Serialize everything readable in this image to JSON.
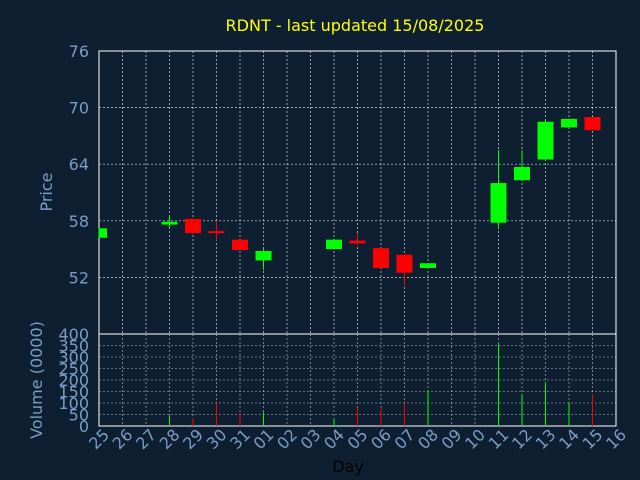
{
  "chart_data": {
    "type": "candlestick",
    "title": "RDNT - last updated 15/08/2025",
    "price_ylabel": "Price",
    "volume_ylabel": "Volume (0000)",
    "xlabel": "Day",
    "x_tick_labels": [
      "25",
      "26",
      "27",
      "28",
      "29",
      "30",
      "31",
      "01",
      "02",
      "03",
      "04",
      "05",
      "06",
      "07",
      "08",
      "09",
      "10",
      "11",
      "12",
      "13",
      "14",
      "15",
      "16"
    ],
    "price_ylim": [
      46,
      76
    ],
    "price_yticks": [
      52,
      58,
      64,
      70,
      76
    ],
    "volume_ylim": [
      0,
      400
    ],
    "volume_yticks": [
      0,
      50,
      100,
      150,
      200,
      250,
      300,
      350,
      400
    ],
    "grid": true,
    "colors": {
      "up": "#00ff00",
      "down": "#ff0000",
      "title": "#ffff00",
      "axis_text": "#7a9cc6",
      "background": "#0f1f32",
      "grid": "#ffffff"
    },
    "candles": [
      {
        "day": "25",
        "open": 56.2,
        "high": 57.2,
        "low": 56.2,
        "close": 57.2,
        "volume": 0
      },
      {
        "day": "28",
        "open": 57.6,
        "high": 58.6,
        "low": 57.3,
        "close": 57.9,
        "volume": 45
      },
      {
        "day": "29",
        "open": 58.2,
        "high": 58.2,
        "low": 56.6,
        "close": 56.7,
        "volume": 35
      },
      {
        "day": "30",
        "open": 56.9,
        "high": 58.0,
        "low": 55.9,
        "close": 56.8,
        "volume": 100
      },
      {
        "day": "31",
        "open": 56.0,
        "high": 56.0,
        "low": 54.9,
        "close": 54.9,
        "volume": 55
      },
      {
        "day": "01",
        "open": 53.8,
        "high": 55.0,
        "low": 52.8,
        "close": 54.8,
        "volume": 60
      },
      {
        "day": "04",
        "open": 55.0,
        "high": 56.1,
        "low": 55.0,
        "close": 56.0,
        "volume": 30
      },
      {
        "day": "05",
        "open": 55.9,
        "high": 56.7,
        "low": 55.4,
        "close": 55.6,
        "volume": 80
      },
      {
        "day": "06",
        "open": 55.1,
        "high": 55.1,
        "low": 53.0,
        "close": 53.0,
        "volume": 80
      },
      {
        "day": "07",
        "open": 54.4,
        "high": 54.4,
        "low": 51.1,
        "close": 52.5,
        "volume": 100
      },
      {
        "day": "08",
        "open": 53.0,
        "high": 53.5,
        "low": 53.0,
        "close": 53.5,
        "volume": 155
      },
      {
        "day": "11",
        "open": 57.8,
        "high": 65.5,
        "low": 57.3,
        "close": 62.0,
        "volume": 355
      },
      {
        "day": "12",
        "open": 62.3,
        "high": 65.5,
        "low": 62.3,
        "close": 63.7,
        "volume": 140
      },
      {
        "day": "13",
        "open": 64.5,
        "high": 68.8,
        "low": 64.5,
        "close": 68.5,
        "volume": 190
      },
      {
        "day": "14",
        "open": 67.9,
        "high": 68.8,
        "low": 67.9,
        "close": 68.8,
        "volume": 100
      },
      {
        "day": "15",
        "open": 69.0,
        "high": 69.0,
        "low": 67.6,
        "close": 67.6,
        "volume": 140
      }
    ]
  }
}
